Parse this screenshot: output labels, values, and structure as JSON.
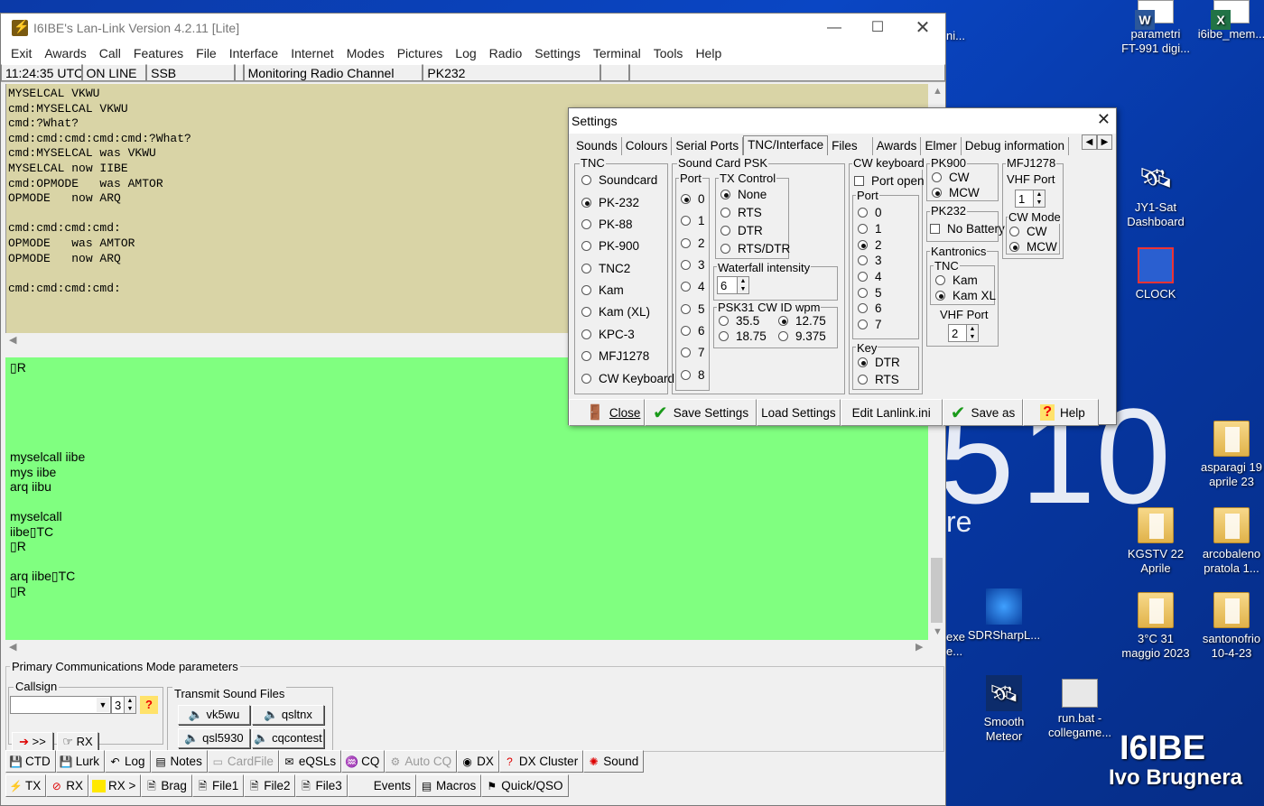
{
  "desktop": {
    "watermark_a": "5",
    "watermark_b": "10",
    "watermark_c": "re",
    "brand_callsign": "I6IBE",
    "brand_name": "Ivo Brugnera",
    "left_labels": [
      "ni...",
      "exe",
      "e..."
    ],
    "icons": [
      {
        "label1": "parametri",
        "label2": "FT-991 digi...",
        "icon": "word-doc-icon"
      },
      {
        "label1": "i6ibe_mem...",
        "label2": "",
        "icon": "excel-doc-icon"
      },
      {
        "label1": "JY1-Sat",
        "label2": "Dashboard",
        "icon": "satellite-icon"
      },
      {
        "label1": "CLOCK",
        "label2": "",
        "icon": "clock-icon"
      },
      {
        "label1": "asparagi 19",
        "label2": "aprile 23",
        "icon": "folder-icon"
      },
      {
        "label1": "KGSTV 22",
        "label2": "Aprile",
        "icon": "folder-icon"
      },
      {
        "label1": "arcobaleno",
        "label2": "pratola 1...",
        "icon": "folder-icon"
      },
      {
        "label1": "SDRSharpL...",
        "label2": "",
        "icon": "sdr-icon"
      },
      {
        "label1": "3°C 31",
        "label2": "maggio 2023",
        "icon": "folder-icon"
      },
      {
        "label1": "santonofrio",
        "label2": "10-4-23",
        "icon": "folder-icon"
      },
      {
        "label1": "Smooth",
        "label2": "Meteor",
        "icon": "satellite-icon"
      },
      {
        "label1": "run.bat -",
        "label2": "collegame...",
        "icon": "batch-file-icon"
      }
    ]
  },
  "window": {
    "title": "I6IBE's Lan-Link Version 4.2.11 [Lite]",
    "menu": [
      "Exit",
      "Awards",
      "Call",
      "Features",
      "File",
      "Interface",
      "Internet",
      "Modes",
      "Pictures",
      "Log",
      "Radio",
      "Settings",
      "Terminal",
      "Tools",
      "Help"
    ],
    "status": {
      "time": "11:24:35 UTC",
      "online": "ON LINE",
      "mode": "SSB",
      "blank1": "",
      "monitor": "Monitoring Radio Channel",
      "tnc": "PK232",
      "blank2": "",
      "blank3": ""
    },
    "terminal_rx": "MYSELCAL VKWU\ncmd:MYSELCAL VKWU\ncmd:?What?\ncmd:cmd:cmd:cmd:cmd:?What?\ncmd:MYSELCAL was VKWU\nMYSELCAL now IIBE\ncmd:OPMODE   was AMTOR\nOPMODE   now ARQ\n\ncmd:cmd:cmd:cmd:\nOPMODE   was AMTOR\nOPMODE   now ARQ\n\ncmd:cmd:cmd:cmd:",
    "terminal_tx": "▯R\n\n\n\n\n\nmyselcall iibe\nmys iibe\narq iibu\n\nmyselcall\niibe▯TC\n▯R\n\narq iibe▯TC\n▯R",
    "pcm": {
      "title": "Primary Communications Mode parameters",
      "callsign_label": "Callsign",
      "callsign_value": "",
      "spin_value": "3",
      "help_glyph": "?",
      "send_label": ">>",
      "rx_label": "RX",
      "tsf_label": "Transmit Sound Files",
      "sound_files": [
        "vk5wu",
        "qsltnx",
        "qsl5930",
        "cqcontest"
      ]
    },
    "toolbar1": [
      {
        "label": "CTD",
        "icon": "disk-icon"
      },
      {
        "label": "Lurk",
        "icon": "disk-icon"
      },
      {
        "label": "Log",
        "icon": "log-icon"
      },
      {
        "label": "Notes",
        "icon": "notes-icon"
      },
      {
        "label": "CardFile",
        "icon": "cardfile-icon",
        "disabled": true
      },
      {
        "label": "eQSLs",
        "icon": "eqsl-icon"
      },
      {
        "label": "CQ",
        "icon": "cq-icon"
      },
      {
        "label": "Auto CQ",
        "icon": "auto-cq-icon",
        "disabled": true
      },
      {
        "label": "DX",
        "icon": "dx-icon"
      },
      {
        "label": "DX Cluster",
        "icon": "dx-cluster-icon"
      },
      {
        "label": "Sound",
        "icon": "sound-icon"
      }
    ],
    "toolbar2": [
      {
        "label": "TX",
        "icon": "tx-icon"
      },
      {
        "label": "RX",
        "icon": "rx-icon"
      },
      {
        "label": "RX >",
        "icon": "rx-forward-icon"
      },
      {
        "label": "Brag",
        "icon": "brag-icon"
      },
      {
        "label": "File1",
        "icon": "file-icon"
      },
      {
        "label": "File2",
        "icon": "file-icon"
      },
      {
        "label": "File3",
        "icon": "file-icon"
      },
      {
        "label": "Events",
        "icon": ""
      },
      {
        "label": "Macros",
        "icon": "macros-icon"
      },
      {
        "label": "Quick/QSO",
        "icon": "quick-qso-icon"
      }
    ]
  },
  "settings": {
    "title": "Settings",
    "tabs": [
      "Sounds",
      "Colours",
      "Serial Ports",
      "TNC/Interface",
      "Files",
      "Awards",
      "Elmer",
      "Debug information"
    ],
    "active_tab": "TNC/Interface",
    "tnc": {
      "title": "TNC",
      "options": [
        "Soundcard",
        "PK-232",
        "PK-88",
        "PK-900",
        "TNC2",
        "Kam",
        "Kam (XL)",
        "KPC-3",
        "MFJ1278",
        "CW Keyboard"
      ],
      "selected": "PK-232"
    },
    "psk": {
      "title": "Sound Card PSK",
      "port_title": "Port",
      "ports": [
        "0",
        "1",
        "2",
        "3",
        "4",
        "5",
        "6",
        "7",
        "8"
      ],
      "port_selected": "0",
      "txc_title": "TX Control",
      "txc": [
        "None",
        "RTS",
        "DTR",
        "RTS/DTR"
      ],
      "txc_selected": "None",
      "waterfall_title": "Waterfall intensity",
      "waterfall_value": "6",
      "cwid_title": "PSK31 CW ID wpm",
      "cwid": [
        "35.5",
        "12.75",
        "18.75",
        "9.375"
      ],
      "cwid_selected": "12.75"
    },
    "cwk": {
      "title": "CW keyboard",
      "port_open": "Port open",
      "port_title": "Port",
      "ports": [
        "0",
        "1",
        "2",
        "3",
        "4",
        "5",
        "6",
        "7"
      ],
      "port_selected": "2",
      "key_title": "Key",
      "keys": [
        "DTR",
        "RTS"
      ],
      "key_selected": "DTR"
    },
    "pk900": {
      "title": "PK900",
      "options": [
        "CW",
        "MCW"
      ],
      "selected": "MCW"
    },
    "pk232": {
      "title": "PK232",
      "no_battery": "No Battery"
    },
    "kantronics": {
      "title": "Kantronics",
      "tnc_title": "TNC",
      "tnc_options": [
        "Kam",
        "Kam XL"
      ],
      "tnc_selected": "Kam XL",
      "vhf_label": "VHF Port",
      "vhf_value": "2"
    },
    "mfj": {
      "title": "MFJ1278",
      "vhf_label": "VHF Port",
      "vhf_value": "1",
      "cw_mode_title": "CW Mode",
      "cw_options": [
        "CW",
        "MCW"
      ],
      "cw_selected": "MCW"
    },
    "buttons": [
      "Close",
      "Save Settings",
      "Load Settings",
      "Edit Lanlink.ini",
      "Save as",
      "Help"
    ]
  }
}
